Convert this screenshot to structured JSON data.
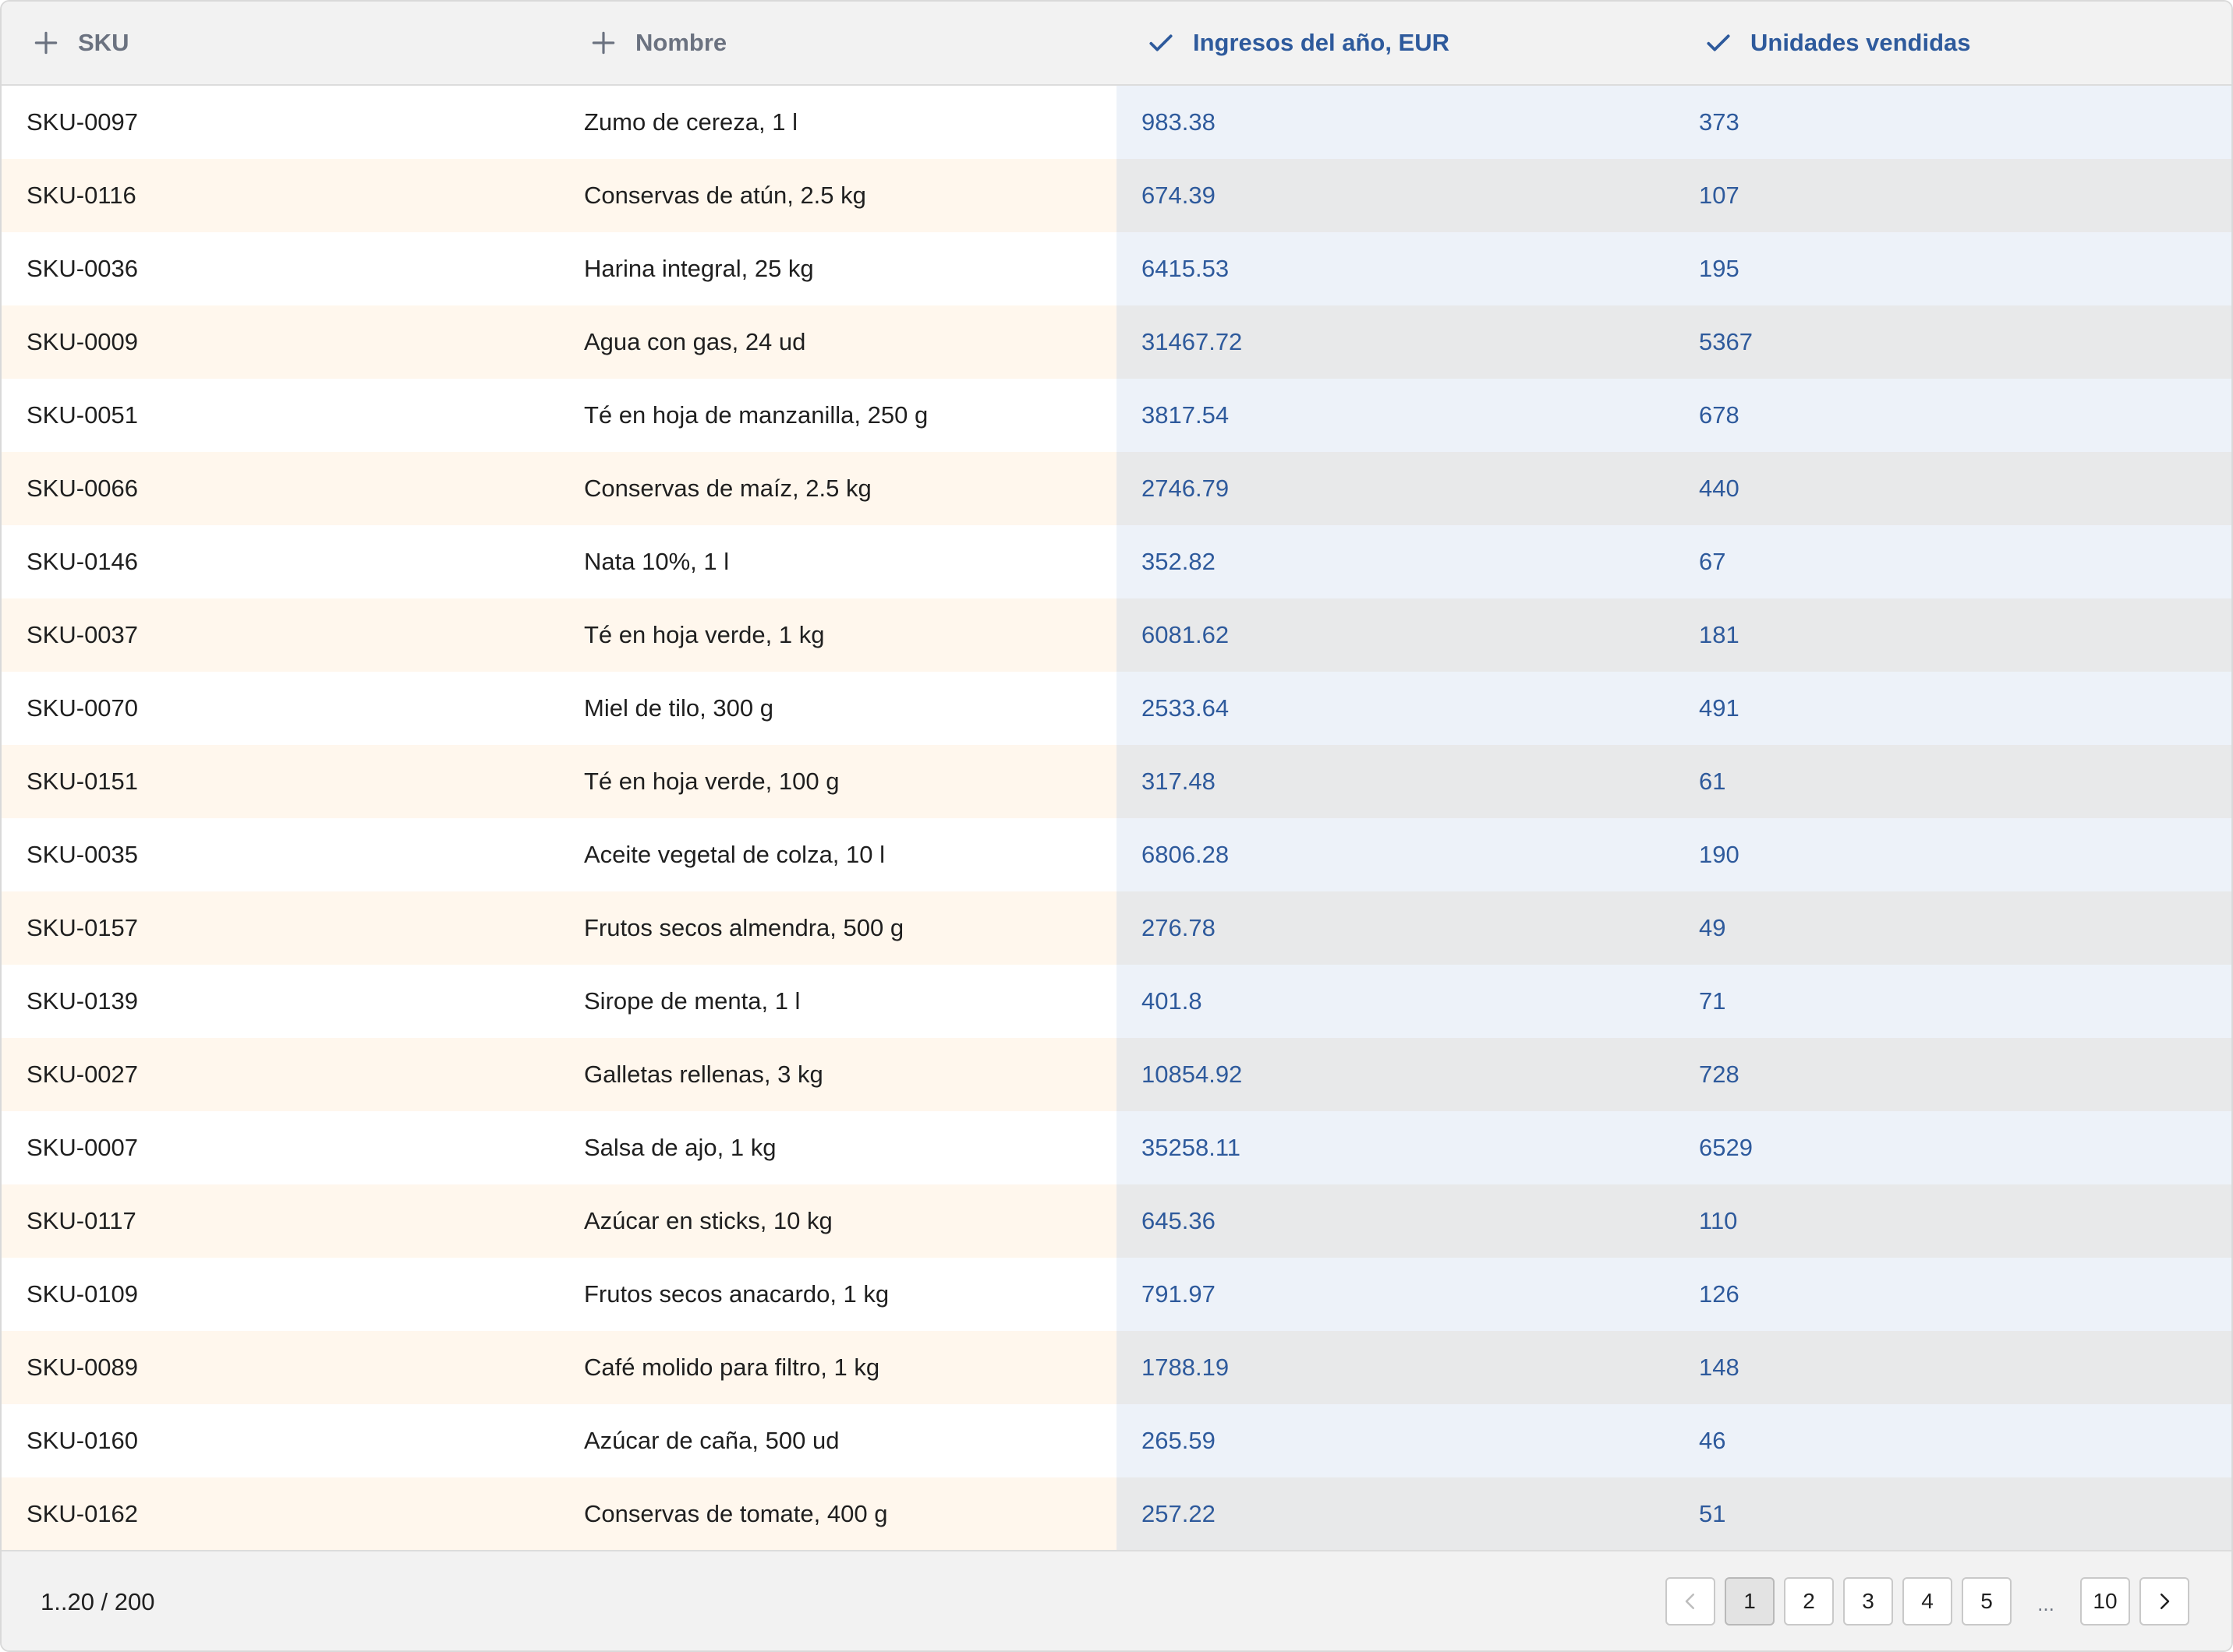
{
  "table": {
    "columns": [
      {
        "label": "SKU",
        "icon": "plus-icon",
        "state": "inactive"
      },
      {
        "label": "Nombre",
        "icon": "plus-icon",
        "state": "inactive"
      },
      {
        "label": "Ingresos del año, EUR",
        "icon": "check-icon",
        "state": "active"
      },
      {
        "label": "Unidades vendidas",
        "icon": "check-icon",
        "state": "active"
      }
    ],
    "rows": [
      [
        "SKU-0097",
        "Zumo de cereza, 1 l",
        "983.38",
        "373"
      ],
      [
        "SKU-0116",
        "Conservas de atún, 2.5 kg",
        "674.39",
        "107"
      ],
      [
        "SKU-0036",
        "Harina integral, 25 kg",
        "6415.53",
        "195"
      ],
      [
        "SKU-0009",
        "Agua con gas, 24 ud",
        "31467.72",
        "5367"
      ],
      [
        "SKU-0051",
        "Té en hoja de manzanilla, 250 g",
        "3817.54",
        "678"
      ],
      [
        "SKU-0066",
        "Conservas de maíz, 2.5 kg",
        "2746.79",
        "440"
      ],
      [
        "SKU-0146",
        "Nata 10%, 1 l",
        "352.82",
        "67"
      ],
      [
        "SKU-0037",
        "Té en hoja verde, 1 kg",
        "6081.62",
        "181"
      ],
      [
        "SKU-0070",
        "Miel de tilo, 300 g",
        "2533.64",
        "491"
      ],
      [
        "SKU-0151",
        "Té en hoja verde, 100 g",
        "317.48",
        "61"
      ],
      [
        "SKU-0035",
        "Aceite vegetal de colza, 10 l",
        "6806.28",
        "190"
      ],
      [
        "SKU-0157",
        "Frutos secos almendra, 500 g",
        "276.78",
        "49"
      ],
      [
        "SKU-0139",
        "Sirope de menta, 1 l",
        "401.8",
        "71"
      ],
      [
        "SKU-0027",
        "Galletas rellenas, 3 kg",
        "10854.92",
        "728"
      ],
      [
        "SKU-0007",
        "Salsa de ajo, 1 kg",
        "35258.11",
        "6529"
      ],
      [
        "SKU-0117",
        "Azúcar en sticks, 10 kg",
        "645.36",
        "110"
      ],
      [
        "SKU-0109",
        "Frutos secos anacardo, 1 kg",
        "791.97",
        "126"
      ],
      [
        "SKU-0089",
        "Café molido para filtro, 1 kg",
        "1788.19",
        "148"
      ],
      [
        "SKU-0160",
        "Azúcar de caña, 500 ud",
        "265.59",
        "46"
      ],
      [
        "SKU-0162",
        "Conservas de tomate, 400 g",
        "257.22",
        "51"
      ]
    ]
  },
  "footer": {
    "range": "1..20 / 200",
    "pages": [
      "1",
      "2",
      "3",
      "4",
      "5"
    ],
    "ellipsis": "...",
    "last_page": "10",
    "current_page": "1",
    "prev_icon": "chevron-left-icon",
    "next_icon": "chevron-right-icon"
  },
  "colors": {
    "accent_blue": "#2e5a9c",
    "header_bg": "#f2f2f2",
    "row_stripe_warm": "#fff7ed",
    "selected_col_bg": "#edf2f9",
    "selected_col_stripe": "#e8e9ea"
  }
}
